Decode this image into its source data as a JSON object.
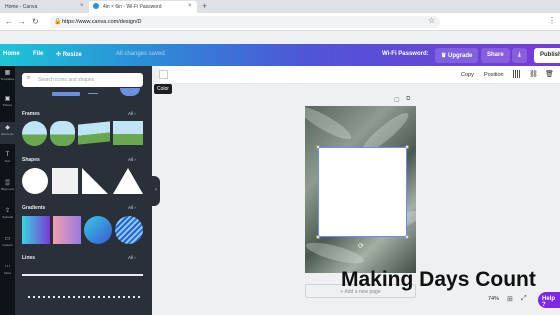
{
  "browser": {
    "tabs": [
      {
        "title": "Home - Canva"
      },
      {
        "title": "4in × 6in - Wi-Fi Password"
      }
    ],
    "url": "https://www.canva.com/design/D"
  },
  "header": {
    "home": "Home",
    "file": "File",
    "resize": "Resize",
    "saved": "All changes saved",
    "doc_title": "Wi-Fi Password",
    "upgrade": "Upgrade",
    "share": "Share",
    "publish": "Publish"
  },
  "rail": [
    "Templates",
    "Photos",
    "Elements",
    "Text",
    "Bkground",
    "Uploads",
    "Folders",
    "More"
  ],
  "panel": {
    "search_placeholder": "Search icons and shapes",
    "see_all": "All",
    "sections": [
      "Frames",
      "Shapes",
      "Gradients",
      "Lines"
    ]
  },
  "tooltip": "Color",
  "toolbar": {
    "copy": "Copy",
    "position": "Position"
  },
  "canvas": {
    "add_page": "+ Add a new page"
  },
  "overlay_text": "Making Days Count",
  "footer": {
    "zoom": "74%",
    "help": "Help ?"
  },
  "colors": {
    "purple": "#7d2ae8",
    "panel": "#293039"
  }
}
